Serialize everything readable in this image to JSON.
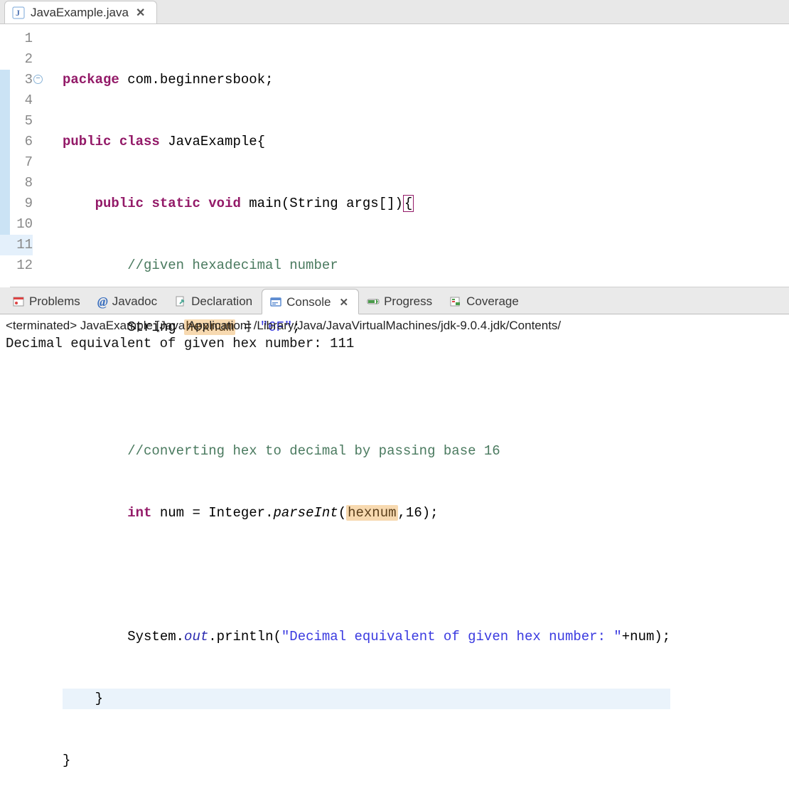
{
  "editor": {
    "tab": {
      "filename": "JavaExample.java"
    },
    "gutter": [
      "1",
      "2",
      "3",
      "4",
      "5",
      "6",
      "7",
      "8",
      "9",
      "10",
      "11",
      "12"
    ]
  },
  "code": {
    "l1": {
      "kw1": "package",
      "rest": " com.beginnersbook;"
    },
    "l2": {
      "kw1": "public",
      "kw2": "class",
      "name": " JavaExample{"
    },
    "l3": {
      "kw1": "public",
      "kw2": "static",
      "kw3": "void",
      "rest": " main(String args[])",
      "brace": "{"
    },
    "l4": {
      "cmt": "//given hexadecimal number"
    },
    "l5": {
      "a": "String ",
      "hl": "hexnum",
      "b": " = ",
      "str": "\"6F\"",
      "c": ";"
    },
    "l7": {
      "cmt": "//converting hex to decimal by passing base 16"
    },
    "l8": {
      "kw": "int",
      "a": " num = Integer.",
      "it": "parseInt",
      "b": "(",
      "hl": "hexnum",
      "c": ",16);"
    },
    "l10": {
      "a": "System.",
      "it": "out",
      "b": ".println(",
      "str": "\"Decimal equivalent of given hex number: \"",
      "c": "+num);"
    },
    "l11": {
      "brace": "}"
    },
    "l12": {
      "brace": "}"
    }
  },
  "bottomTabs": {
    "problems": "Problems",
    "javadoc": "Javadoc",
    "declaration": "Declaration",
    "console": "Console",
    "progress": "Progress",
    "coverage": "Coverage"
  },
  "console": {
    "header": "<terminated> JavaExample [Java Application] /Library/Java/JavaVirtualMachines/jdk-9.0.4.jdk/Contents/",
    "output": "Decimal equivalent of given hex number: 111"
  }
}
